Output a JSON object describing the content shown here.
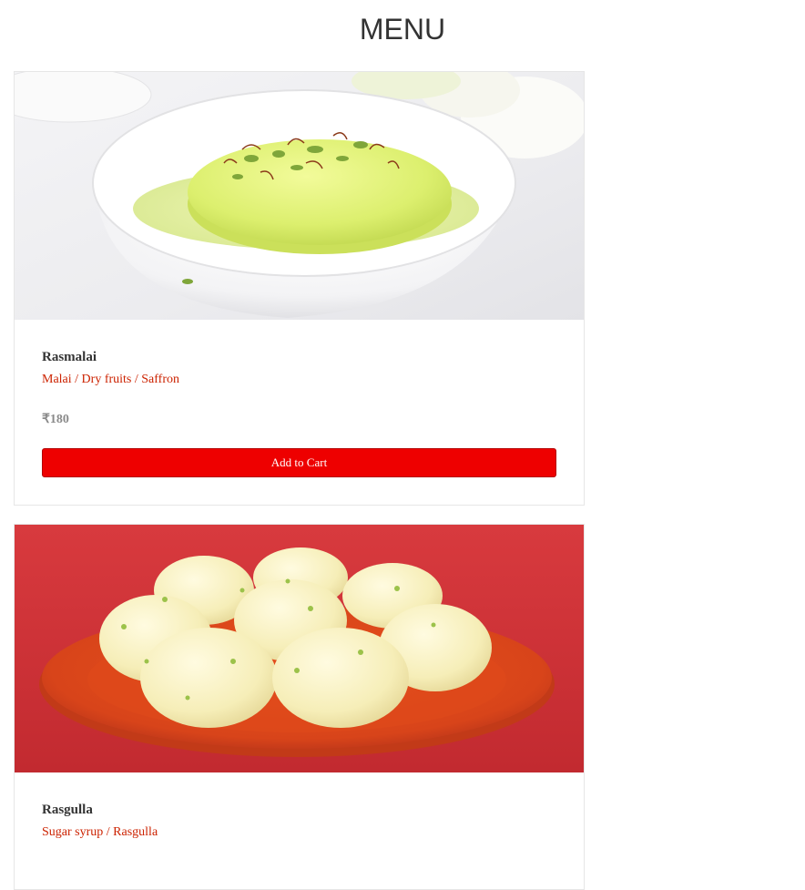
{
  "page": {
    "title": "MENU"
  },
  "items": [
    {
      "name": "Rasmalai",
      "description": "Malai / Dry fruits / Saffron",
      "price": "₹180",
      "button_label": "Add to Cart",
      "image_icon": "rasmalai-bowl-image"
    },
    {
      "name": "Rasgulla",
      "description": "Sugar syrup / Rasgulla",
      "image_icon": "rasgulla-plate-image"
    }
  ],
  "colors": {
    "accent_button": "#ee0000",
    "description_text": "#cc2200",
    "price_text": "#8a8a8a",
    "card_border": "#e6e6e6"
  }
}
